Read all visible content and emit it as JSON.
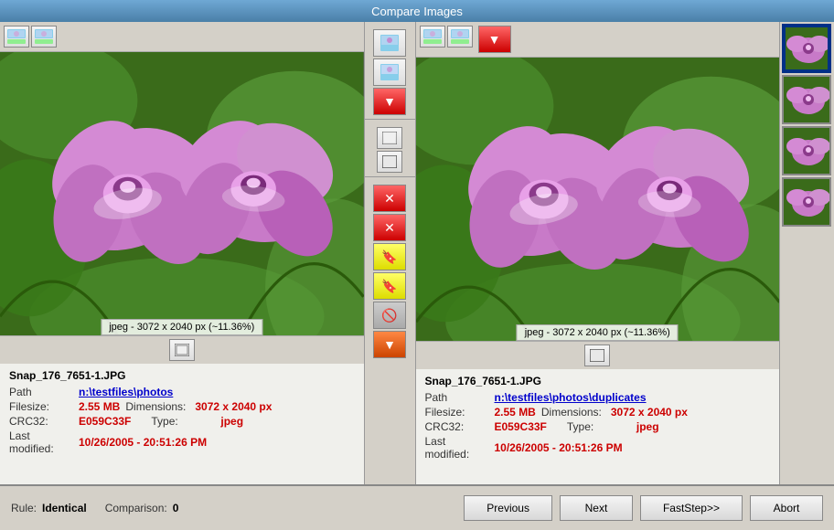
{
  "window": {
    "title": "Compare Images"
  },
  "left_panel": {
    "filename": "Snap_176_7651-1.JPG",
    "path_label": "Path",
    "path_value": "n:\\testfiles\\photos",
    "filesize_label": "Filesize:",
    "filesize_value": "2.55 MB",
    "dimensions_label": "Dimensions:",
    "dimensions_value": "3072 x 2040 px",
    "crc_label": "CRC32:",
    "crc_value": "E059C33F",
    "type_label": "Type:",
    "type_value": "jpeg",
    "modified_label": "Last modified:",
    "modified_value": "10/26/2005 - 20:51:26 PM",
    "image_info": "jpeg - 3072 x 2040 px (~11.36%)"
  },
  "right_panel": {
    "filename": "Snap_176_7651-1.JPG",
    "path_label": "Path",
    "path_value": "n:\\testfiles\\photos\\duplicates",
    "filesize_label": "Filesize:",
    "filesize_value": "2.55 MB",
    "dimensions_label": "Dimensions:",
    "dimensions_value": "3072 x 2040 px",
    "crc_label": "CRC32:",
    "crc_value": "E059C33F",
    "type_label": "Type:",
    "type_value": "jpeg",
    "modified_label": "Last modified:",
    "modified_value": "10/26/2005 - 20:51:26 PM",
    "image_info": "jpeg - 3072 x 2040 px (~11.36%)"
  },
  "status_bar": {
    "rule_label": "Rule:",
    "rule_value": "Identical",
    "comparison_label": "Comparison:",
    "comparison_value": "0"
  },
  "buttons": {
    "previous": "Previous",
    "next": "Next",
    "faststep": "FastStep>>",
    "abort": "Abort"
  },
  "thumbnails": [
    {
      "id": "thumb-1",
      "active": true
    },
    {
      "id": "thumb-2",
      "active": false
    },
    {
      "id": "thumb-3",
      "active": false
    },
    {
      "id": "thumb-4",
      "active": false
    }
  ]
}
